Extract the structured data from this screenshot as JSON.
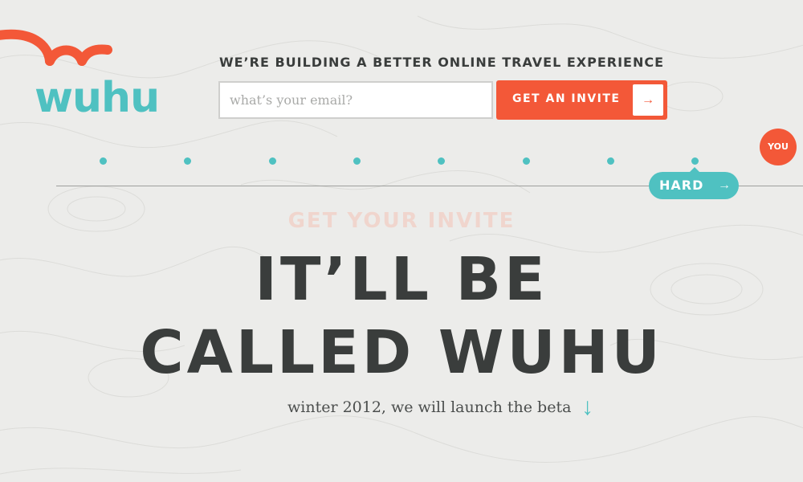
{
  "logo": {
    "text": "wuhu",
    "arc_icon": "wave-arc-icon"
  },
  "header": {
    "tagline": "WE’RE BUILDING A BETTER ONLINE TRAVEL EXPERIENCE"
  },
  "signup": {
    "email_placeholder": "what’s your email?",
    "email_value": "",
    "button_label": "GET AN INVITE",
    "button_arrow": "→"
  },
  "timeline": {
    "you_label": "YOU",
    "hard_label": "HARD",
    "hard_arrow": "→",
    "dot_count": 8
  },
  "hero": {
    "ghost_title": "GET YOUR INVITE",
    "line1": "IT’LL BE",
    "line2": "CALLED WUHU",
    "subline": "winter 2012, we will launch the beta",
    "down_arrow": "↓"
  },
  "colors": {
    "accent_orange": "#f35838",
    "accent_teal": "#4fc1c1",
    "text_dark": "#3a3d3c",
    "background": "#ececea"
  }
}
